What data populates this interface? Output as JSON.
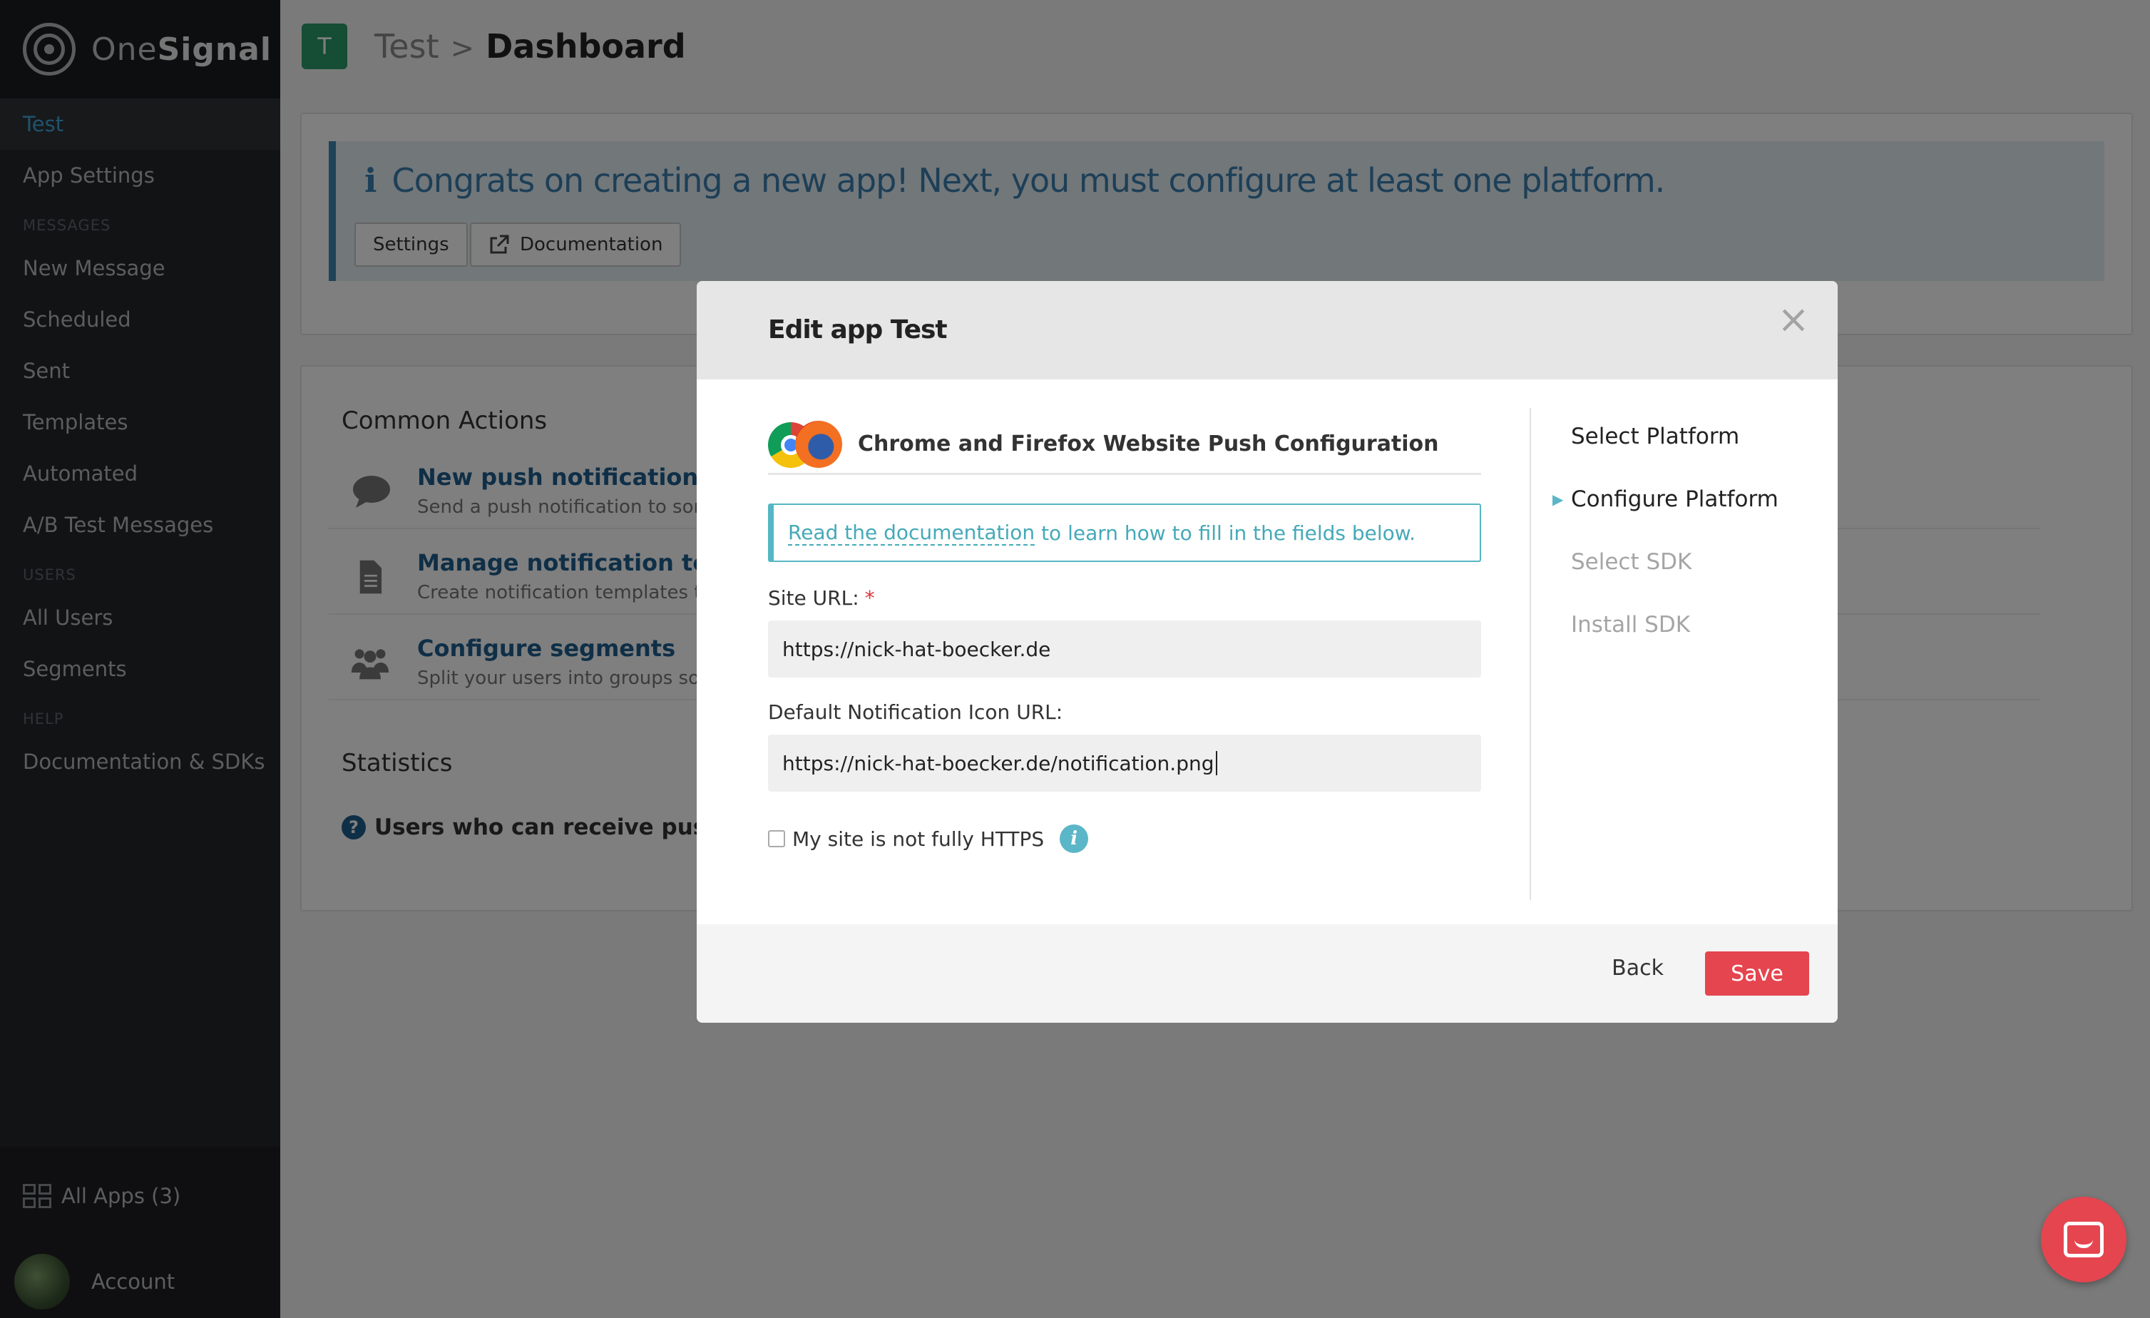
{
  "brand": {
    "name_light": "One",
    "name_bold": "Signal"
  },
  "sidebar": {
    "app_name": "Test",
    "app_settings": "App Settings",
    "sections": {
      "messages": "MESSAGES",
      "users": "USERS",
      "help": "HELP"
    },
    "messages_items": [
      "New Message",
      "Scheduled",
      "Sent",
      "Templates",
      "Automated",
      "A/B Test Messages"
    ],
    "users_items": [
      "All Users",
      "Segments"
    ],
    "help_items": [
      "Documentation & SDKs"
    ],
    "all_apps": "All Apps (3)",
    "account": "Account"
  },
  "header": {
    "app_badge": "T",
    "breadcrumb_app": "Test",
    "breadcrumb_sep": ">",
    "breadcrumb_page": "Dashboard"
  },
  "banner": {
    "info_glyph": "i",
    "message": "Congrats on creating a new app! Next, you must configure at least one platform.",
    "settings_button": "Settings",
    "documentation_button": "Documentation"
  },
  "common_actions": {
    "title": "Common Actions",
    "items": [
      {
        "title": "New push notification",
        "desc": "Send a push notification to some"
      },
      {
        "title": "Manage notification templ",
        "desc": "Create notification templates tha"
      },
      {
        "title": "Configure segments",
        "desc": "Split your users into groups so y"
      }
    ]
  },
  "statistics": {
    "title": "Statistics",
    "line": "Users who can receive push no"
  },
  "modal": {
    "title": "Edit app Test",
    "close": "×",
    "config_title": "Chrome and Firefox Website Push Configuration",
    "doc_link": "Read the documentation",
    "doc_rest": " to learn how to fill in the fields below.",
    "site_url_label": "Site URL:",
    "required_mark": "*",
    "site_url_value": "https://nick-hat-boecker.de",
    "icon_url_label": "Default Notification Icon URL:",
    "icon_url_value": "https://nick-hat-boecker.de/notification.png",
    "https_checkbox_label": "My site is not fully HTTPS",
    "https_checked": false,
    "info_glyph": "i",
    "steps": [
      {
        "label": "Select Platform",
        "state": "done"
      },
      {
        "label": "Configure Platform",
        "state": "active"
      },
      {
        "label": "Select SDK",
        "state": "pending"
      },
      {
        "label": "Install SDK",
        "state": "pending"
      }
    ],
    "back_button": "Back",
    "save_button": "Save"
  },
  "colors": {
    "accent_blue": "#3fa7d8",
    "save_red": "#e5454f",
    "teal": "#55b7c3",
    "app_badge_green": "#2a9a6a"
  }
}
